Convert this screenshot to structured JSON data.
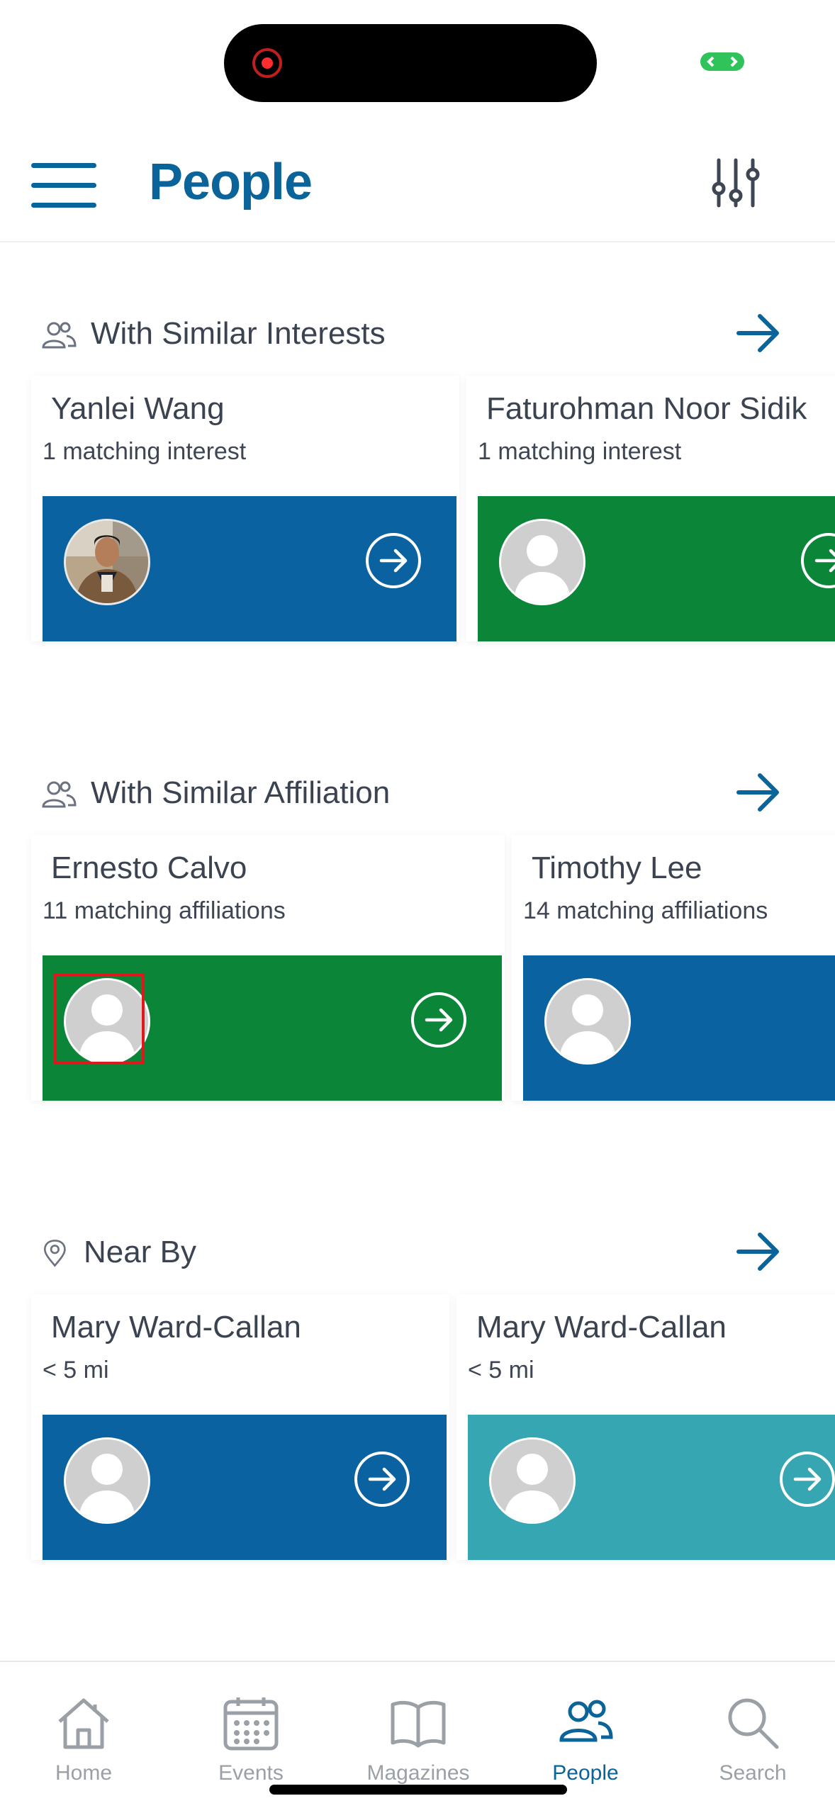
{
  "header": {
    "title": "People",
    "menu_icon": "hamburger-menu-icon",
    "filter_icon": "sliders-icon"
  },
  "colors": {
    "accent": "#0a6499",
    "blue_band": "#0b62a0",
    "green_band": "#0b8638",
    "teal_band": "#36a7b2",
    "tab_inactive": "#9aa0a6"
  },
  "sections": [
    {
      "title": "With Similar Interests",
      "icon": "people-icon",
      "cards": [
        {
          "name": "Yanlei Wang",
          "subtitle": "1 matching interest",
          "band": "blue",
          "avatar": "photo"
        },
        {
          "name": "Faturohman Noor Sidik",
          "subtitle": "1 matching interest",
          "band": "green",
          "avatar": "placeholder"
        }
      ]
    },
    {
      "title": "With Similar Affiliation",
      "icon": "people-icon",
      "cards": [
        {
          "name": "Ernesto Calvo",
          "subtitle": "11 matching affiliations",
          "band": "green",
          "avatar": "placeholder"
        },
        {
          "name": "Timothy Lee",
          "subtitle": "14 matching affiliations",
          "band": "blue",
          "avatar": "placeholder"
        }
      ]
    },
    {
      "title": "Near By",
      "icon": "location-pin-icon",
      "cards": [
        {
          "name": "Mary Ward-Callan",
          "subtitle": "< 5 mi",
          "band": "blue",
          "avatar": "placeholder"
        },
        {
          "name": "Mary Ward-Callan",
          "subtitle": "< 5 mi",
          "band": "teal",
          "avatar": "placeholder"
        }
      ]
    }
  ],
  "tabs": [
    {
      "label": "Home",
      "icon": "home-icon",
      "active": false
    },
    {
      "label": "Events",
      "icon": "calendar-icon",
      "active": false
    },
    {
      "label": "Magazines",
      "icon": "book-icon",
      "active": false
    },
    {
      "label": "People",
      "icon": "people-icon",
      "active": true
    },
    {
      "label": "Search",
      "icon": "search-icon",
      "active": false
    }
  ]
}
